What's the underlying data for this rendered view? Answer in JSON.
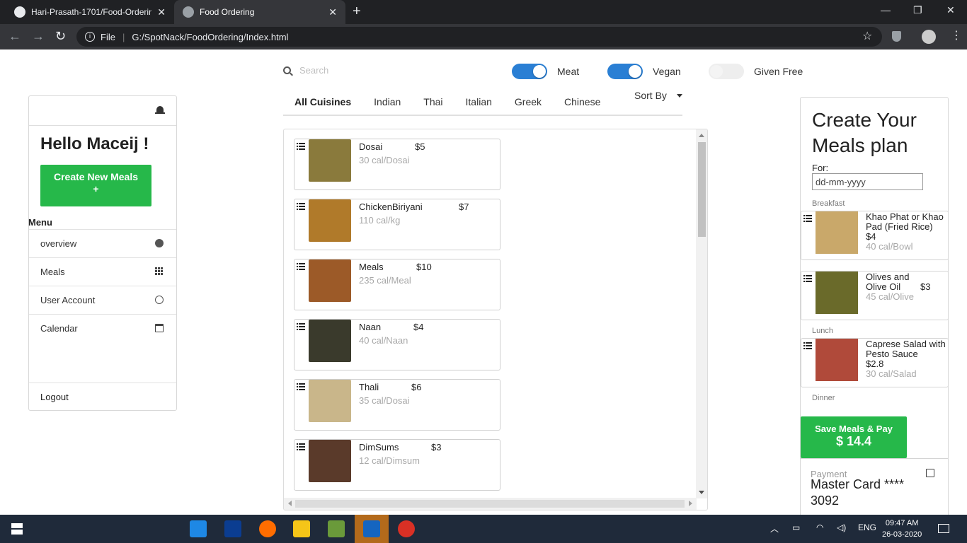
{
  "browser": {
    "tabs": [
      {
        "title": "Hari-Prasath-1701/Food-Ordering",
        "active": false
      },
      {
        "title": "Food Ordering",
        "active": true
      }
    ],
    "url_scheme": "File",
    "url": "G:/SpotNack/FoodOrdering/Index.html"
  },
  "search": {
    "placeholder": "Search"
  },
  "filters": [
    {
      "label": "Meat",
      "on": true
    },
    {
      "label": "Vegan",
      "on": true
    },
    {
      "label": "Given Free",
      "on": false
    }
  ],
  "cuisines": [
    "All Cuisines",
    "Indian",
    "Thai",
    "Italian",
    "Greek",
    "Chinese"
  ],
  "selected_cuisine": "All Cuisines",
  "sort_label": "Sort By",
  "meals": [
    {
      "name": "Dosai",
      "price": "$5",
      "cal": "30 cal/Dosai",
      "color": "#8a7a3c"
    },
    {
      "name": "ChickenBiriyani",
      "price": "$7",
      "cal": "110 cal/kg",
      "color": "#b07a2a"
    },
    {
      "name": "Meals",
      "price": "$10",
      "cal": "235 cal/Meal",
      "color": "#9c5a28"
    },
    {
      "name": "Naan",
      "price": "$4",
      "cal": "40 cal/Naan",
      "color": "#3a3a2c"
    },
    {
      "name": "Thali",
      "price": "$6",
      "cal": "35 cal/Dosai",
      "color": "#c9b68a"
    },
    {
      "name": "DimSums",
      "price": "$3",
      "cal": "12 cal/Dimsum",
      "color": "#5a3a2a"
    }
  ],
  "sidebar": {
    "greeting": "Hello Maceij !",
    "create_label": "Create New Meals",
    "create_plus": "+",
    "menu_label": "Menu",
    "items": [
      {
        "label": "overview",
        "icon": "globe-icon"
      },
      {
        "label": "Meals",
        "icon": "grid-icon"
      },
      {
        "label": "User Account",
        "icon": "smile-icon"
      },
      {
        "label": "Calendar",
        "icon": "calendar-icon"
      }
    ],
    "logout": "Logout"
  },
  "plan": {
    "title": "Create Your Meals plan",
    "for_label": "For:",
    "date_placeholder": "dd-mm-yyyy",
    "sections": {
      "breakfast": "Breakfast",
      "lunch": "Lunch",
      "dinner": "Dinner"
    },
    "breakfast_items": [
      {
        "name": "Khao Phat or Khao Pad (Fried Rice)",
        "price": "$4",
        "cal": "40 cal/Bowl",
        "color": "#c9a86a"
      },
      {
        "name": "Olives and Olive Oil",
        "price": "$3",
        "cal": "45 cal/Olive",
        "color": "#6a6a2a"
      }
    ],
    "lunch_items": [
      {
        "name": "Caprese Salad with Pesto Sauce",
        "price": "$2.8",
        "cal": "30 cal/Salad",
        "color": "#b04a3a"
      }
    ],
    "save_label": "Save Meals & Pay",
    "total": "$ 14.4",
    "payment_label": "Payment",
    "card": "Master Card **** 3092"
  },
  "taskbar": {
    "time": "09:47 AM",
    "date": "26-03-2020",
    "lang": "ENG"
  },
  "colors": {
    "accent_green": "#26b84a",
    "toggle_blue": "#2a7fd4"
  }
}
